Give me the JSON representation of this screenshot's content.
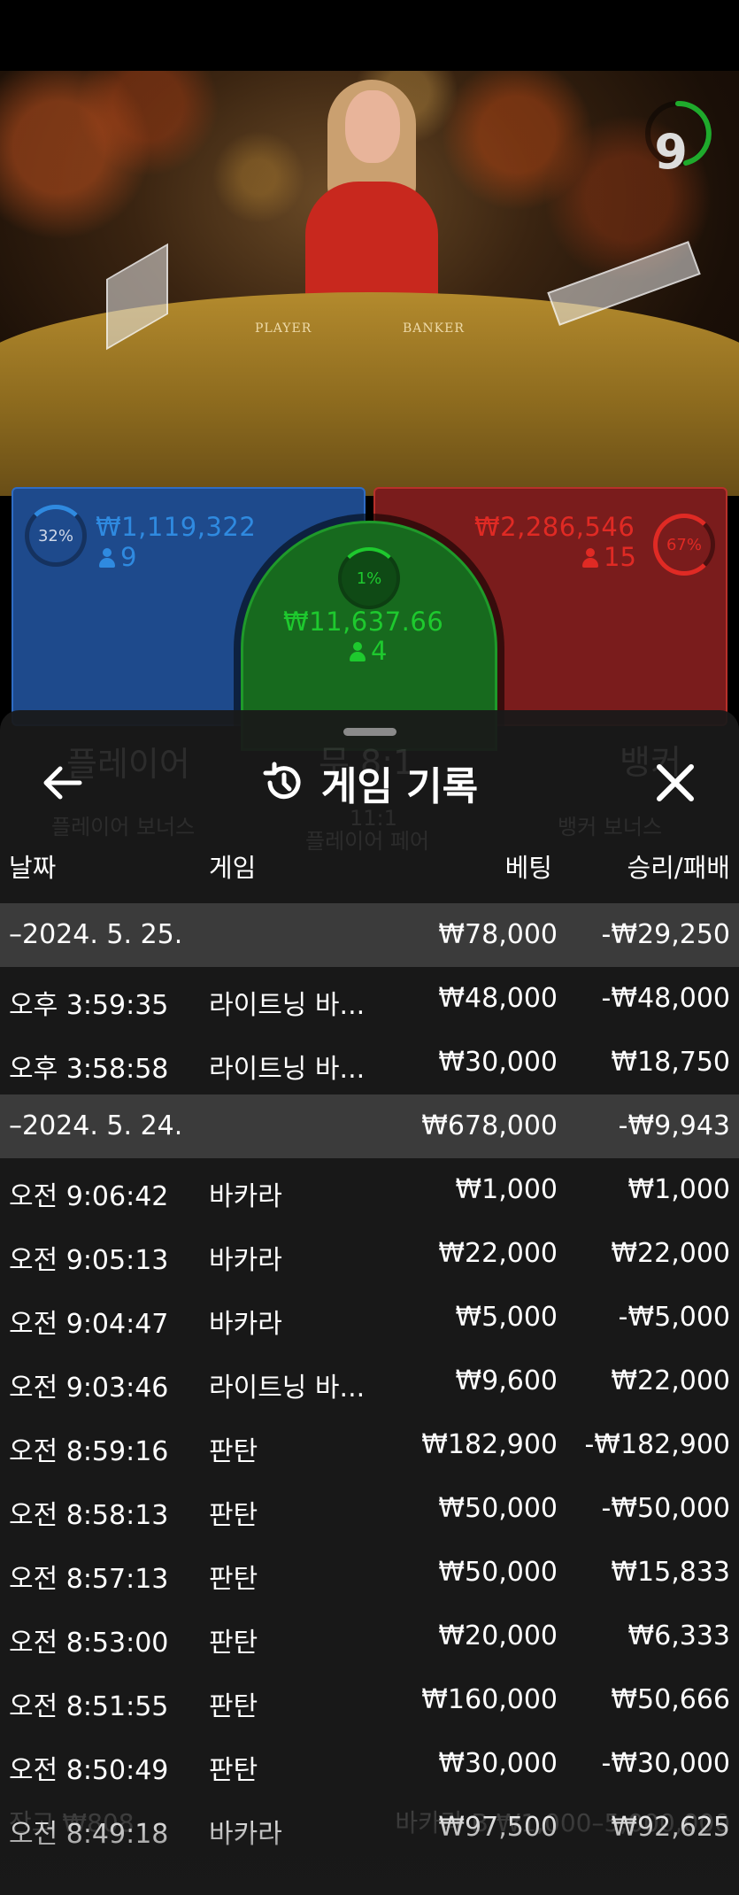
{
  "timer": {
    "value": "9"
  },
  "table_labels": {
    "player": "PLAYER",
    "banker": "BANKER"
  },
  "bets": {
    "player": {
      "percent": "32%",
      "amount": "₩1,119,322",
      "count": "9"
    },
    "tie": {
      "percent": "1%",
      "amount": "₩11,637.66",
      "count": "4"
    },
    "banker": {
      "percent": "67%",
      "amount": "₩2,286,546",
      "count": "15"
    }
  },
  "colors": {
    "player": "#1e4a8c",
    "banker": "#7a1c1c",
    "tie": "#176a1e",
    "tie_text": "#1ec92e",
    "player_text": "#2f8ae0",
    "banker_text": "#e02a24",
    "date_row": "#3b3b3b"
  },
  "history": {
    "title": "게임 기록",
    "icons": {
      "back": "arrow-left-icon",
      "history": "history-clock-icon",
      "close": "close-icon"
    },
    "columns": {
      "date": "날짜",
      "game": "게임",
      "bet": "베팅",
      "winloss": "승리/패배"
    },
    "rows": [
      {
        "type": "date",
        "date": "–2024. 5. 25.",
        "game": "",
        "bet": "₩78,000",
        "winloss": "-₩29,250"
      },
      {
        "type": "item",
        "date": "오후 3:59:35",
        "game": "라이트닝 바...",
        "bet": "₩48,000",
        "winloss": "-₩48,000"
      },
      {
        "type": "item",
        "date": "오후 3:58:58",
        "game": "라이트닝 바...",
        "bet": "₩30,000",
        "winloss": "₩18,750"
      },
      {
        "type": "date",
        "date": "–2024. 5. 24.",
        "game": "",
        "bet": "₩678,000",
        "winloss": "-₩9,943"
      },
      {
        "type": "item",
        "date": "오전 9:06:42",
        "game": "바카라",
        "bet": "₩1,000",
        "winloss": "₩1,000"
      },
      {
        "type": "item",
        "date": "오전 9:05:13",
        "game": "바카라",
        "bet": "₩22,000",
        "winloss": "₩22,000"
      },
      {
        "type": "item",
        "date": "오전 9:04:47",
        "game": "바카라",
        "bet": "₩5,000",
        "winloss": "-₩5,000"
      },
      {
        "type": "item",
        "date": "오전 9:03:46",
        "game": "라이트닝 바...",
        "bet": "₩9,600",
        "winloss": "₩22,000"
      },
      {
        "type": "item",
        "date": "오전 8:59:16",
        "game": "판탄",
        "bet": "₩182,900",
        "winloss": "-₩182,900"
      },
      {
        "type": "item",
        "date": "오전 8:58:13",
        "game": "판탄",
        "bet": "₩50,000",
        "winloss": "-₩50,000"
      },
      {
        "type": "item",
        "date": "오전 8:57:13",
        "game": "판탄",
        "bet": "₩50,000",
        "winloss": "₩15,833"
      },
      {
        "type": "item",
        "date": "오전 8:53:00",
        "game": "판탄",
        "bet": "₩20,000",
        "winloss": "₩6,333"
      },
      {
        "type": "item",
        "date": "오전 8:51:55",
        "game": "판탄",
        "bet": "₩160,000",
        "winloss": "₩50,666"
      },
      {
        "type": "item",
        "date": "오전 8:50:49",
        "game": "판탄",
        "bet": "₩30,000",
        "winloss": "-₩30,000"
      },
      {
        "type": "item",
        "date": "오전 8:49:18",
        "game": "바카라",
        "bet": "₩97,500",
        "winloss": "₩92,625"
      }
    ]
  },
  "background_ghost_text": {
    "player": "플레이어",
    "tie": "무 8:1",
    "banker": "뱅커",
    "player_bonus": "플레이어 보너스",
    "player_pair_odds": "11:1",
    "player_pair": "플레이어 페어",
    "banker_bonus": "뱅커 보너스",
    "balance": "잔고 ₩808",
    "limits": "바카라 B ₩1,000–5,000,000"
  }
}
